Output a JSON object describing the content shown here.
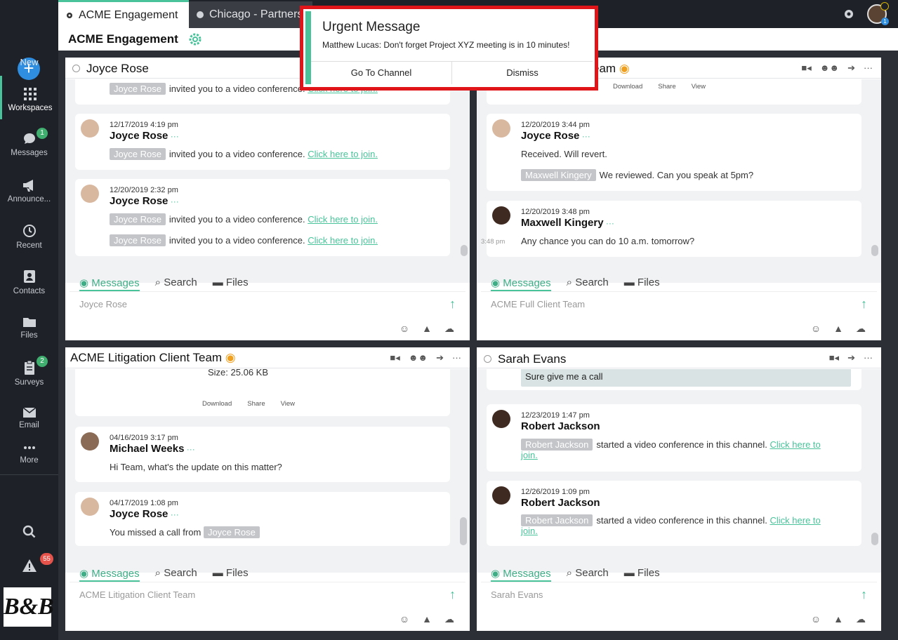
{
  "sidebar": {
    "new": "New",
    "workspaces": "Workspaces",
    "messages": "Messages",
    "messages_badge": "1",
    "announcements": "Announce...",
    "recent": "Recent",
    "contacts": "Contacts",
    "files": "Files",
    "surveys": "Surveys",
    "surveys_badge": "2",
    "email": "Email",
    "more": "More",
    "alerts_badge": "55",
    "logo": "B&B"
  },
  "tabs": [
    {
      "label": "ACME Engagement"
    },
    {
      "label": "Chicago - Partners"
    }
  ],
  "workspace": {
    "title": "ACME Engagement"
  },
  "urgent": {
    "title": "Urgent Message",
    "body": "Matthew Lucas: Don't forget Project XYZ meeting is in 10 minutes!",
    "go": "Go To Channel",
    "dismiss": "Dismiss"
  },
  "panel_tabs": {
    "messages": "Messages",
    "search": "Search",
    "files": "Files"
  },
  "panels": {
    "p1": {
      "title": "Joyce Rose",
      "input": "Joyce Rose",
      "m0": {
        "chip": "Joyce Rose",
        "text": "invited you to a video conference.",
        "link": "Click here to join."
      },
      "m1": {
        "ts": "12/17/2019 4:19 pm",
        "name": "Joyce Rose",
        "chip": "Joyce Rose",
        "text": "invited you to a video conference.",
        "link": "Click here to join."
      },
      "m2": {
        "ts": "12/20/2019 2:32 pm",
        "name": "Joyce Rose",
        "chip": "Joyce Rose",
        "text": "invited you to a video conference.",
        "link": "Click here to join.",
        "chip2": "Joyce Rose",
        "text2": "invited you to a video conference.",
        "link2": "Click here to join."
      }
    },
    "p2": {
      "title": "eam",
      "input": "ACME Full Client Team",
      "fa": {
        "download": "Download",
        "share": "Share",
        "view": "View"
      },
      "m1": {
        "ts": "12/20/2019 3:44 pm",
        "name": "Joyce Rose",
        "text": "Received. Will revert.",
        "chip": "Maxwell Kingery",
        "text2": "We reviewed. Can you speak at 5pm?"
      },
      "m2": {
        "side": "3:48 pm",
        "ts": "12/20/2019 3:48 pm",
        "name": "Maxwell Kingery",
        "text": "Any chance you can do 10 a.m. tomorrow?"
      }
    },
    "p3": {
      "title": "ACME Litigation Client Team",
      "input": "ACME Litigation Client Team",
      "size": "Size: 25.06 KB",
      "fa": {
        "download": "Download",
        "share": "Share",
        "view": "View"
      },
      "m1": {
        "ts": "04/16/2019 3:17 pm",
        "name": "Michael Weeks",
        "text": "Hi Team, what's the update on this matter?"
      },
      "m2": {
        "ts": "04/17/2019 1:08 pm",
        "name": "Joyce Rose",
        "text": "You missed a call from",
        "chip": "Joyce Rose"
      }
    },
    "p4": {
      "title": "Sarah Evans",
      "input": "Sarah Evans",
      "reply": "Sure give me a call",
      "m1": {
        "ts": "12/23/2019 1:47 pm",
        "name": "Robert Jackson",
        "chip": "Robert Jackson",
        "text": "started a video conference in this channel.",
        "link": "Click here to",
        "link2": "join."
      },
      "m2": {
        "ts": "12/26/2019 1:09 pm",
        "name": "Robert Jackson",
        "chip": "Robert Jackson",
        "text": "started a video conference in this channel.",
        "link": "Click here to",
        "link2": "join."
      }
    }
  }
}
